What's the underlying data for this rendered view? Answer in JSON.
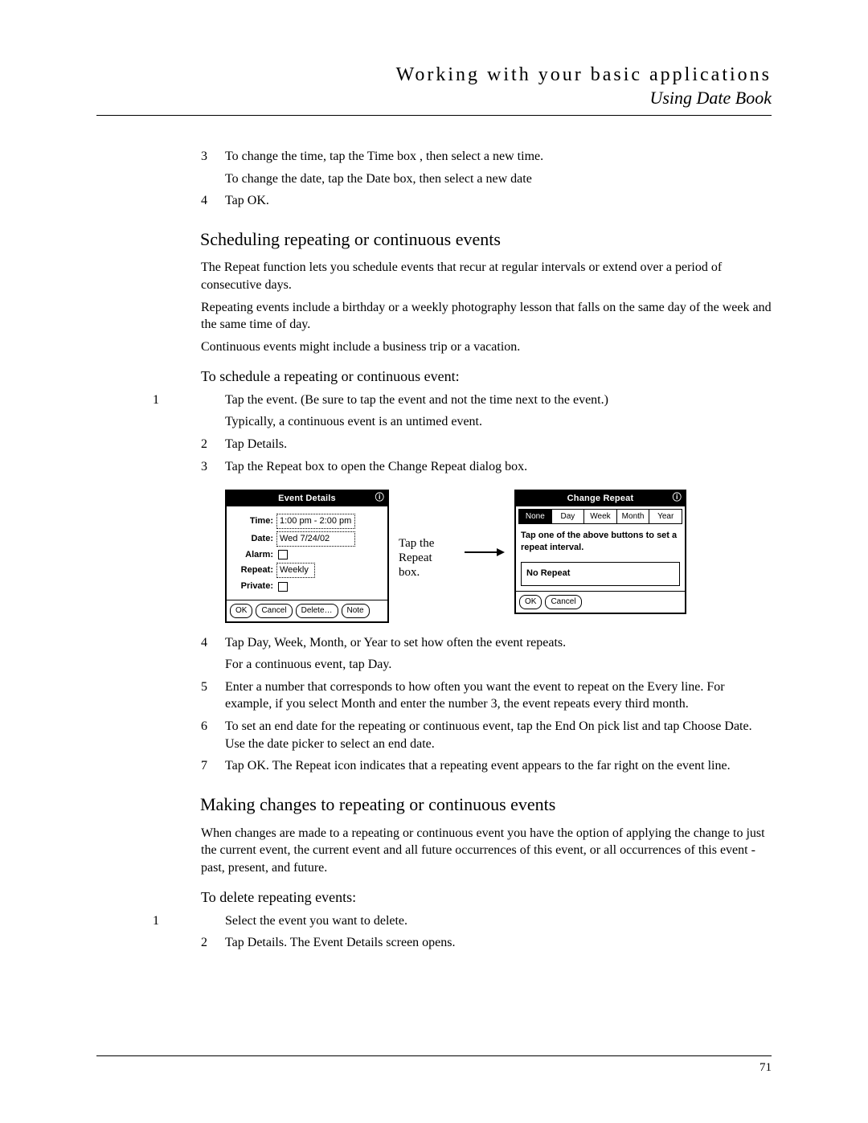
{
  "header": {
    "chapter": "Working with your basic applications",
    "section": "Using Date Book"
  },
  "intro_steps": [
    {
      "num": "3",
      "lines": [
        "To change the time, tap the Time box , then select a new time.",
        "To change the date, tap the Date box, then select a new date"
      ]
    },
    {
      "num": "4",
      "lines": [
        "Tap OK."
      ]
    }
  ],
  "sec1": {
    "title": "Scheduling repeating or continuous events",
    "paras": [
      "The Repeat function lets you schedule events that recur at regular intervals or extend over a period of consecutive days.",
      "Repeating events include a birthday or a weekly photography lesson that falls on the same day of the week and the same time of day.",
      "Continuous events might include a business trip or a vacation."
    ],
    "subhead": "To schedule a repeating or continuous event:",
    "steps_a": [
      {
        "num": "1",
        "lines": [
          "Tap the event. (Be sure to tap the event and not the time next to the event.)",
          "Typically, a continuous event is an untimed event."
        ]
      },
      {
        "num": "2",
        "lines": [
          "Tap Details."
        ]
      },
      {
        "num": "3",
        "lines": [
          "Tap the Repeat box to open the Change Repeat dialog box."
        ]
      }
    ],
    "steps_b": [
      {
        "num": "4",
        "lines": [
          "Tap Day, Week, Month, or Year to set how often the event repeats.",
          "For a continuous event, tap Day."
        ]
      },
      {
        "num": "5",
        "lines": [
          "Enter a number that corresponds to how often you want the event to repeat on the Every line. For example, if you select Month and enter the number 3, the event repeats every third month."
        ]
      },
      {
        "num": "6",
        "lines": [
          "To set an end date for the repeating or continuous event, tap the End On pick list and tap Choose Date. Use the date picker to select an end date."
        ]
      },
      {
        "num": "7",
        "lines": [
          "Tap OK. The Repeat icon indicates that a repeating event appears to the far right on the event line."
        ]
      }
    ]
  },
  "sec2": {
    "title": "Making changes to repeating or continuous events",
    "para": "When changes are made to a repeating or continuous event you have the option of applying the change to just the current event, the current event and all future occurrences of this event, or all occurrences of this event - past, present, and future.",
    "subhead": "To delete repeating events:",
    "steps": [
      {
        "num": "1",
        "lines": [
          "Select the event you want to delete."
        ]
      },
      {
        "num": "2",
        "lines": [
          "Tap Details. The Event Details screen opens."
        ]
      }
    ]
  },
  "figure": {
    "event_details": {
      "title": "Event Details",
      "info_glyph": "ⓘ",
      "time_label": "Time:",
      "time_value": "1:00 pm - 2:00 pm",
      "date_label": "Date:",
      "date_value": "Wed 7/24/02",
      "alarm_label": "Alarm:",
      "repeat_label": "Repeat:",
      "repeat_value": "Weekly",
      "private_label": "Private:",
      "buttons": {
        "ok": "OK",
        "cancel": "Cancel",
        "delete": "Delete…",
        "note": "Note"
      }
    },
    "callout": "Tap the Repeat box.",
    "change_repeat": {
      "title": "Change Repeat",
      "info_glyph": "ⓘ",
      "tabs": {
        "none": "None",
        "day": "Day",
        "week": "Week",
        "month": "Month",
        "year": "Year"
      },
      "selected_tab": "none",
      "instruction": "Tap one of the above buttons to set a repeat interval.",
      "result": "No Repeat",
      "buttons": {
        "ok": "OK",
        "cancel": "Cancel"
      }
    }
  },
  "page_number": "71"
}
